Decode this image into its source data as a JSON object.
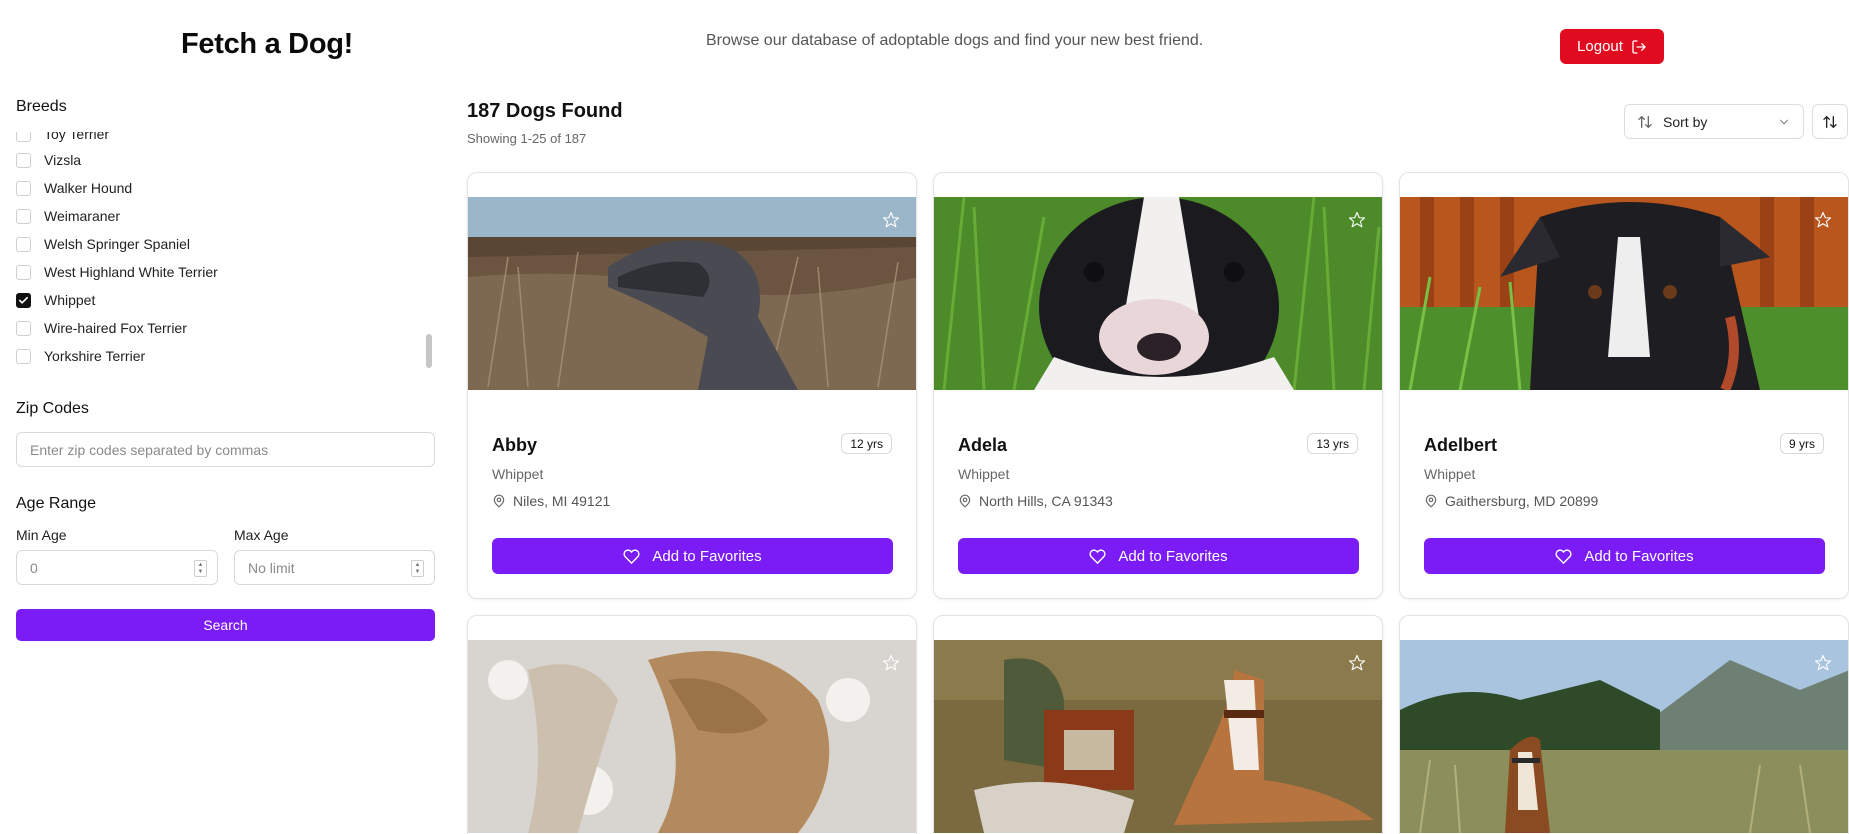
{
  "header": {
    "title": "Fetch a Dog!",
    "tagline": "Browse our database of adoptable dogs and find your new best friend.",
    "logout_label": "Logout"
  },
  "sidebar": {
    "breeds_label": "Breeds",
    "breeds": [
      {
        "name": "Toy Terrier",
        "checked": false
      },
      {
        "name": "Vizsla",
        "checked": false
      },
      {
        "name": "Walker Hound",
        "checked": false
      },
      {
        "name": "Weimaraner",
        "checked": false
      },
      {
        "name": "Welsh Springer Spaniel",
        "checked": false
      },
      {
        "name": "West Highland White Terrier",
        "checked": false
      },
      {
        "name": "Whippet",
        "checked": true
      },
      {
        "name": "Wire-haired Fox Terrier",
        "checked": false
      },
      {
        "name": "Yorkshire Terrier",
        "checked": false
      }
    ],
    "zip_label": "Zip Codes",
    "zip_placeholder": "Enter zip codes separated by commas",
    "age_label": "Age Range",
    "min_age_label": "Min Age",
    "min_age_placeholder": "0",
    "max_age_label": "Max Age",
    "max_age_placeholder": "No limit",
    "search_label": "Search"
  },
  "results": {
    "title": "187 Dogs Found",
    "subtitle": "Showing 1-25 of 187",
    "sort_label": "Sort by"
  },
  "cards": [
    {
      "name": "Abby",
      "age": "12 yrs",
      "breed": "Whippet",
      "location": "Niles, MI 49121",
      "button": "Add to Favorites"
    },
    {
      "name": "Adela",
      "age": "13 yrs",
      "breed": "Whippet",
      "location": "North Hills, CA 91343",
      "button": "Add to Favorites"
    },
    {
      "name": "Adelbert",
      "age": "9 yrs",
      "breed": "Whippet",
      "location": "Gaithersburg, MD 20899",
      "button": "Add to Favorites"
    }
  ],
  "colors": {
    "accent": "#7b1cf6",
    "logout": "#e00b1e"
  }
}
